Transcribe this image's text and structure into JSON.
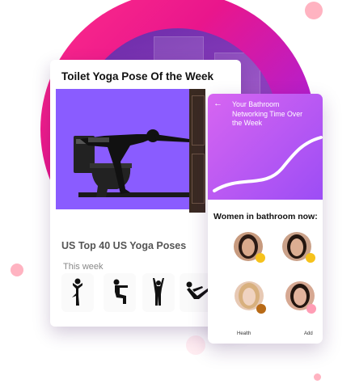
{
  "colors": {
    "ring_gradient": [
      "#ff2d8a",
      "#b21fd0",
      "#7b2df0"
    ],
    "hero_background": "#8a5cff",
    "card_header_gradient": [
      "#d765f1",
      "#9c4df5"
    ],
    "badge_yellow": "#f6c21c",
    "badge_brown": "#b86a16",
    "badge_pink": "#ff9db5",
    "accent_pink": "#ffb3c1"
  },
  "main_card": {
    "title": "Toilet Yoga Pose Of the Week",
    "hero_image": "person-yoga-pose-on-toilet",
    "section_title": "US Top 40 US Yoga Poses",
    "subheading": "This week",
    "poses": [
      {
        "icon": "tree-pose-icon"
      },
      {
        "icon": "chair-pose-icon"
      },
      {
        "icon": "arms-raised-pose-icon"
      },
      {
        "icon": "boat-pose-icon"
      }
    ]
  },
  "side_card": {
    "back_icon": "arrow-left-icon",
    "header_text": "Your Bathroom Networking Time Over the Week",
    "section_title": "Women in bathroom now:",
    "people": [
      {
        "avatar": "woman-dark-hair-avatar",
        "badge_color": "#f6c21c",
        "label": ""
      },
      {
        "avatar": "woman-dark-hair-avatar",
        "badge_color": "#f6c21c",
        "label": ""
      },
      {
        "avatar": "woman-blonde-avatar",
        "badge_color": "#b86a16",
        "label": "Health"
      },
      {
        "avatar": "woman-dark-hair-avatar",
        "badge_color": "#ff9db5",
        "label": "Add"
      }
    ]
  }
}
